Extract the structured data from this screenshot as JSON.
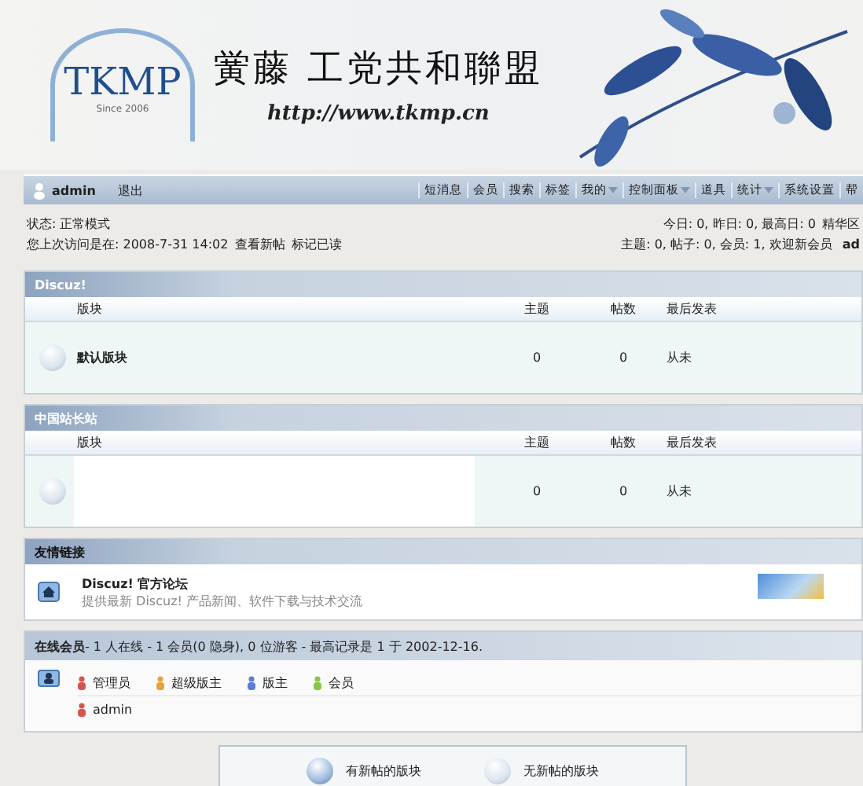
{
  "banner": {
    "logo": "TKMP",
    "since": "Since 2006",
    "title": "黉藤 工党共和聯盟",
    "url": "http://www.tkmp.cn"
  },
  "userbar": {
    "user": "admin",
    "logout": "退出"
  },
  "nav": [
    {
      "label": "短消息",
      "dropdown": false
    },
    {
      "label": "会员",
      "dropdown": false
    },
    {
      "label": "搜索",
      "dropdown": false
    },
    {
      "label": "标签",
      "dropdown": false
    },
    {
      "label": "我的",
      "dropdown": true
    },
    {
      "label": "控制面板",
      "dropdown": true
    },
    {
      "label": "道具",
      "dropdown": false
    },
    {
      "label": "统计",
      "dropdown": true
    },
    {
      "label": "系统设置",
      "dropdown": false
    },
    {
      "label": "帮",
      "dropdown": false
    }
  ],
  "status": {
    "left": [
      "状态: 正常模式",
      "您上次访问是在: 2008-7-31 14:02"
    ],
    "links": [
      "查看新帖",
      "标记已读"
    ],
    "right": [
      "今日: 0, 昨日: 0, 最高日: 0",
      "主题: 0, 帖子: 0, 会员: 1, 欢迎新会员 "
    ],
    "right_links": [
      "精华区",
      "ad"
    ]
  },
  "categories": [
    {
      "title": "Discuz!",
      "columns": [
        "版块",
        "主题",
        "帖数",
        "最后发表"
      ],
      "forums": [
        {
          "name": "默认版块",
          "redacted": false,
          "new_posts": false,
          "threads": "0",
          "posts": "0",
          "last": "从未"
        }
      ]
    },
    {
      "title": "中国站长站",
      "columns": [
        "版块",
        "主题",
        "帖数",
        "最后发表"
      ],
      "forums": [
        {
          "redacted": true,
          "new_posts": false,
          "threads": "0",
          "posts": "0",
          "last": "从未"
        }
      ]
    }
  ],
  "links": {
    "title": "友情链接",
    "items": [
      {
        "name": "Discuz! 官方论坛",
        "description": "提供最新 Discuz! 产品新闻、软件下载与技术交流"
      }
    ]
  },
  "online": {
    "title": "在线会员",
    "summary": " - 1 人在线 - 1 会员(0 隐身), 0 位游客 - 最高记录是 1 于 2002-12-16.",
    "legend": [
      {
        "label": "管理员",
        "color": "#d9534f"
      },
      {
        "label": "超级版主",
        "color": "#e8a23a"
      },
      {
        "label": "版主",
        "color": "#5b7fd1"
      },
      {
        "label": "会员",
        "color": "#8cc34a"
      }
    ],
    "users": [
      {
        "name": "admin",
        "color": "#d9534f"
      }
    ]
  },
  "legend": [
    {
      "label": "有新帖的版块",
      "new_posts": true
    },
    {
      "label": "无新帖的版块",
      "new_posts": false
    }
  ]
}
